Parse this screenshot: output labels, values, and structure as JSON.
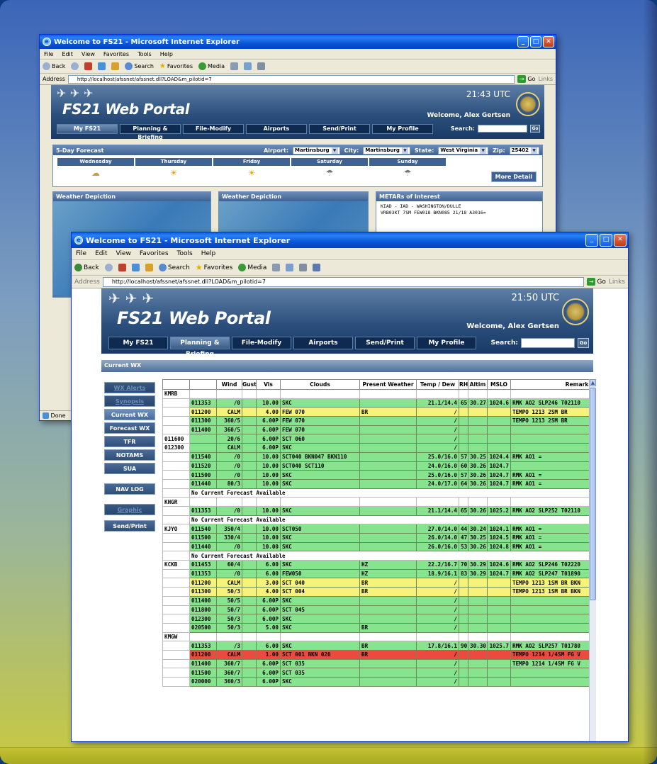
{
  "back_window": {
    "title": "Welcome to FS21 - Microsoft Internet Explorer",
    "menu": [
      "File",
      "Edit",
      "View",
      "Favorites",
      "Tools",
      "Help"
    ],
    "toolbar": {
      "back": "Back",
      "search": "Search",
      "favorites": "Favorites",
      "media": "Media"
    },
    "address_label": "Address",
    "address": "http://localhost/afssnet/afssnet.dll?LOAD&m_pilotid=7",
    "go": "Go",
    "links": "Links",
    "clock": "21:43 UTC",
    "portal_title": "FS21 Web Portal",
    "welcome": "Welcome, Alex Gertsen",
    "nav": [
      "My FS21",
      "Planning & Briefing",
      "File-Modify",
      "Airports",
      "Send/Print",
      "My Profile"
    ],
    "search_label": "Search:",
    "search_go": "Go",
    "forecast": {
      "title": "5-Day Forecast",
      "airport_label": "Airport:",
      "airport": "Martinsburg",
      "city_label": "City:",
      "city": "Martinsburg",
      "state_label": "State:",
      "state": "West Virginia",
      "zip_label": "Zip:",
      "zip": "25402",
      "days": [
        "Wednesday",
        "Thursday",
        "Friday",
        "Saturday",
        "Sunday"
      ],
      "more_detail": "More Detail"
    },
    "panels": {
      "weather_depiction_1": "Weather Depiction",
      "weather_depiction_2": "Weather Depiction",
      "metars_title": "METARs of Interest",
      "metar_line1": "KIAD - IAD - WASHINGTON/DULLE",
      "metar_line2": "VRB03KT 7SM FEW018 BKN085 21/18 A3016="
    },
    "status": "Done"
  },
  "front_window": {
    "title": "Welcome to FS21 - Microsoft Internet Explorer",
    "menu": [
      "File",
      "Edit",
      "View",
      "Favorites",
      "Tools",
      "Help"
    ],
    "toolbar": {
      "back": "Back",
      "search": "Search",
      "favorites": "Favorites",
      "media": "Media"
    },
    "address_label": "Address",
    "address": "http://localhost/afssnet/afssnet.dll?LOAD&m_pilotid=7",
    "go": "Go",
    "links": "Links",
    "clock": "21:50 UTC",
    "portal_title": "FS21 Web Portal",
    "welcome": "Welcome, Alex Gertsen",
    "nav": [
      "My FS21",
      "Planning & Briefing",
      "File-Modify",
      "Airports",
      "Send/Print",
      "My Profile"
    ],
    "search_label": "Search:",
    "search_go": "Go",
    "section": "Current WX",
    "side_menu": [
      "WX Alerts",
      "Synopsis",
      "Current WX",
      "Forecast WX",
      "TFR",
      "NOTAMS",
      "SUA",
      "NAV LOG",
      "Graphic",
      "Send/Print"
    ],
    "columns": [
      "",
      "",
      "Wind",
      "Gust",
      "Vis",
      "Clouds",
      "Present Weather",
      "Temp / Dew",
      "RH",
      "Altim",
      "MSLO",
      "Remarks"
    ],
    "rows": [
      {
        "c": "w",
        "v": [
          "KMRB",
          "",
          "",
          "",
          "",
          "",
          "",
          "",
          "",
          "",
          "",
          ""
        ]
      },
      {
        "c": "g",
        "v": [
          "",
          "011353",
          "/0",
          "",
          "10.00",
          "SKC",
          "",
          "21.1/14.4",
          "65",
          "30.27",
          "1024.6",
          "RMK AO2 SLP246 T02110"
        ]
      },
      {
        "c": "y",
        "v": [
          "",
          "011200",
          "CALM",
          "",
          "4.00",
          "FEW 070",
          "BR",
          "/",
          "",
          "",
          "",
          "TEMPO 1213 2SM BR"
        ]
      },
      {
        "c": "g",
        "v": [
          "",
          "011300",
          "360/5",
          "",
          "6.00P",
          "FEW 070",
          "",
          "/",
          "",
          "",
          "",
          "TEMPO 1213 2SM BR"
        ]
      },
      {
        "c": "g",
        "v": [
          "",
          "011400",
          "360/5",
          "",
          "6.00P",
          "FEW 070",
          "",
          "/",
          "",
          "",
          "",
          ""
        ]
      },
      {
        "c": "g",
        "v": [
          "011600",
          "",
          "20/6",
          "",
          "6.00P",
          "SCT 060",
          "",
          "/",
          "",
          "",
          "",
          ""
        ]
      },
      {
        "c": "g",
        "v": [
          "012300",
          "",
          "CALM",
          "",
          "6.00P",
          "SKC",
          "",
          "/",
          "",
          "",
          "",
          ""
        ]
      },
      {
        "c": "g",
        "v": [
          "",
          "011540",
          "/0",
          "",
          "10.00",
          "SCT040 BKN047 BKN110",
          "",
          "25.0/16.0",
          "57",
          "30.25",
          "1024.4",
          "RMK AO1 ="
        ]
      },
      {
        "c": "g",
        "v": [
          "",
          "011520",
          "/0",
          "",
          "10.00",
          "SCT040 SCT110",
          "",
          "24.0/16.0",
          "60",
          "30.26",
          "1024.7",
          ""
        ]
      },
      {
        "c": "g",
        "v": [
          "",
          "011500",
          "/0",
          "",
          "10.00",
          "SKC",
          "",
          "25.0/16.0",
          "57",
          "30.26",
          "1024.7",
          "RMK AO1 ="
        ]
      },
      {
        "c": "g",
        "v": [
          "",
          "011440",
          "80/3",
          "",
          "10.00",
          "SKC",
          "",
          "24.0/17.0",
          "64",
          "30.26",
          "1024.7",
          "RMK AO1 ="
        ]
      },
      {
        "c": "w",
        "v": [
          "",
          "No Current Forecast Available",
          "",
          "",
          "",
          "",
          "",
          "",
          "",
          "",
          "",
          ""
        ]
      },
      {
        "c": "w",
        "v": [
          "KHGR",
          "",
          "",
          "",
          "",
          "",
          "",
          "",
          "",
          "",
          "",
          ""
        ]
      },
      {
        "c": "g",
        "v": [
          "",
          "011353",
          "/0",
          "",
          "10.00",
          "SKC",
          "",
          "21.1/14.4",
          "65",
          "30.26",
          "1025.2",
          "RMK AO2 SLP252 T02110"
        ]
      },
      {
        "c": "w",
        "v": [
          "",
          "No Current Forecast Available",
          "",
          "",
          "",
          "",
          "",
          "",
          "",
          "",
          "",
          ""
        ]
      },
      {
        "c": "g",
        "v": [
          "KJYO",
          "011540",
          "350/4",
          "",
          "10.00",
          "SCT050",
          "",
          "27.0/14.0",
          "44",
          "30.24",
          "1024.1",
          "RMK AO1 ="
        ]
      },
      {
        "c": "g",
        "v": [
          "",
          "011500",
          "330/4",
          "",
          "10.00",
          "SKC",
          "",
          "26.0/14.0",
          "47",
          "30.25",
          "1024.5",
          "RMK AO1 ="
        ]
      },
      {
        "c": "g",
        "v": [
          "",
          "011440",
          "/0",
          "",
          "10.00",
          "SKC",
          "",
          "26.0/16.0",
          "53",
          "30.26",
          "1024.8",
          "RMK AO1 ="
        ]
      },
      {
        "c": "w",
        "v": [
          "",
          "No Current Forecast Available",
          "",
          "",
          "",
          "",
          "",
          "",
          "",
          "",
          "",
          ""
        ]
      },
      {
        "c": "g",
        "v": [
          "KCKB",
          "011453",
          "60/4",
          "",
          "6.00",
          "SKC",
          "HZ",
          "22.2/16.7",
          "70",
          "30.29",
          "1024.6",
          "RMK AO2 SLP246 T02220"
        ]
      },
      {
        "c": "g",
        "v": [
          "",
          "011353",
          "/0",
          "",
          "6.00",
          "FEW050",
          "HZ",
          "18.9/16.1",
          "83",
          "30.29",
          "1024.7",
          "RMK AO2 SLP247 T01890"
        ]
      },
      {
        "c": "y",
        "v": [
          "",
          "011200",
          "CALM",
          "",
          "3.00",
          "SCT 040",
          "BR",
          "/",
          "",
          "",
          "",
          "TEMPO 1213 1SM BR BKN"
        ]
      },
      {
        "c": "y",
        "v": [
          "",
          "011300",
          "50/3",
          "",
          "4.00",
          "SCT 004",
          "BR",
          "/",
          "",
          "",
          "",
          "TEMPO 1213 1SM BR BKN"
        ]
      },
      {
        "c": "g",
        "v": [
          "",
          "011400",
          "50/5",
          "",
          "6.00P",
          "SKC",
          "",
          "/",
          "",
          "",
          "",
          ""
        ]
      },
      {
        "c": "g",
        "v": [
          "",
          "011800",
          "50/7",
          "",
          "6.00P",
          "SCT 045",
          "",
          "/",
          "",
          "",
          "",
          ""
        ]
      },
      {
        "c": "g",
        "v": [
          "",
          "012300",
          "50/3",
          "",
          "6.00P",
          "SKC",
          "",
          "/",
          "",
          "",
          "",
          ""
        ]
      },
      {
        "c": "g",
        "v": [
          "",
          "020500",
          "50/3",
          "",
          "5.00",
          "SKC",
          "BR",
          "/",
          "",
          "",
          "",
          ""
        ]
      },
      {
        "c": "w",
        "v": [
          "KMGW",
          "",
          "",
          "",
          "",
          "",
          "",
          "",
          "",
          "",
          "",
          ""
        ]
      },
      {
        "c": "g",
        "v": [
          "",
          "011353",
          "/3",
          "",
          "6.00",
          "SKC",
          "BR",
          "17.8/16.1",
          "90",
          "30.30",
          "1025.7",
          "RMK AO2 SLP257 T01780"
        ]
      },
      {
        "c": "r",
        "v": [
          "",
          "011200",
          "CALM",
          "",
          "1.00",
          "SCT 001 BKN 020",
          "BR",
          "/",
          "",
          "",
          "",
          "TEMPO 1214 1/4SM FG V"
        ]
      },
      {
        "c": "g",
        "v": [
          "",
          "011400",
          "360/7",
          "",
          "6.00P",
          "SCT 035",
          "",
          "/",
          "",
          "",
          "",
          "TEMPO 1214 1/4SM FG V"
        ]
      },
      {
        "c": "g",
        "v": [
          "",
          "011500",
          "360/7",
          "",
          "6.00P",
          "SCT 035",
          "",
          "/",
          "",
          "",
          "",
          ""
        ]
      },
      {
        "c": "g",
        "v": [
          "",
          "020000",
          "360/3",
          "",
          "6.00P",
          "SKC",
          "",
          "/",
          "",
          "",
          "",
          ""
        ]
      }
    ]
  },
  "colors": {
    "ok": "#86e38e",
    "caution": "#f6f27a",
    "warning": "#ec4a3e"
  }
}
